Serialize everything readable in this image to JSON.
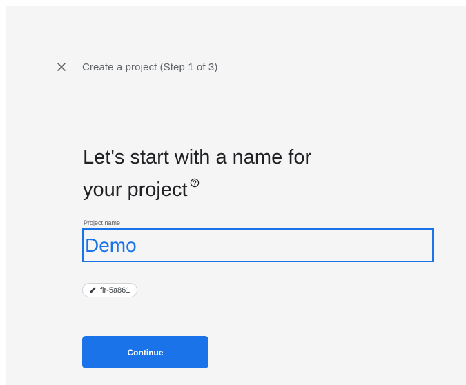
{
  "header": {
    "close_icon": "close-icon",
    "title": "Create a project (Step 1 of 3)"
  },
  "main": {
    "heading_line1": "Let's start with a name for",
    "heading_line2": "your project",
    "help_icon": "help-circle-icon",
    "project_name": {
      "label": "Project name",
      "value": "Demo"
    },
    "project_id_chip": {
      "icon": "pencil-icon",
      "text": "fir-5a861"
    },
    "continue_label": "Continue"
  },
  "colors": {
    "accent": "#1a73e8",
    "background": "#f5f5f5",
    "heading": "#202124",
    "secondary_text": "#5f6368"
  }
}
